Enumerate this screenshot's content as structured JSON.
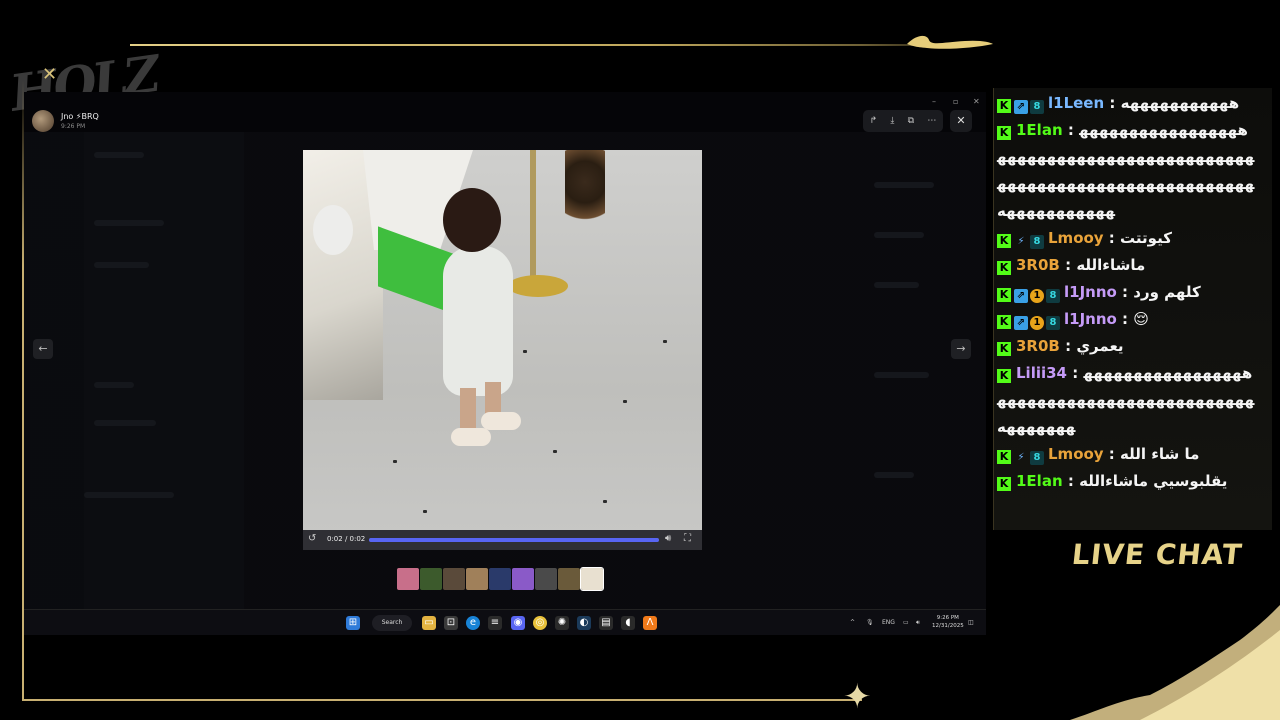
{
  "overlay": {
    "logo_text": "HOLZ",
    "live_chat_label": "LIVE CHAT",
    "accent": "#c8b072"
  },
  "viewer": {
    "user": "Jno ⚡BRQ",
    "time": "9:26 PM",
    "tools": [
      "share-icon",
      "download-icon",
      "open-external-icon",
      "more-icon"
    ],
    "close": "✕",
    "prev": "←",
    "next": "→",
    "video": {
      "time_display": "0:02 / 0:02",
      "progress": 1.0,
      "accent": "#5865f2"
    },
    "thumbnail_count": 9
  },
  "taskbar": {
    "search_label": "Search",
    "lang": "ENG",
    "clock_time": "9:26 PM",
    "clock_date": "12/31/2025"
  },
  "chat": {
    "messages": [
      {
        "badges": [
          "kick",
          "blue",
          "cyan"
        ],
        "user": "l1Leen",
        "color": "#79b8ff",
        "text": "هههههههههههه"
      },
      {
        "badges": [
          "kick"
        ],
        "user": "1Elan",
        "color": "#53fc18",
        "text": "ههههههههههههههههههههههههههههههههههههههههههههههههههههههههههههههههههههههههههههههههه"
      },
      {
        "badges": [
          "kick",
          "spark",
          "cyan"
        ],
        "user": "Lmooy",
        "color": "#e9a33a",
        "text": "كيوتتت"
      },
      {
        "badges": [
          "kick"
        ],
        "user": "3R0B",
        "color": "#e9a33a",
        "text": "ماشاءالله"
      },
      {
        "badges": [
          "kick",
          "blue",
          "gold",
          "cyan"
        ],
        "user": "l1Jnno",
        "color": "#c59bf7",
        "text": "كلهم ورد"
      },
      {
        "badges": [
          "kick",
          "blue",
          "gold",
          "cyan"
        ],
        "user": "l1Jnno",
        "color": "#c59bf7",
        "text": "😌"
      },
      {
        "badges": [
          "kick"
        ],
        "user": "3R0B",
        "color": "#e9a33a",
        "text": "يعمري"
      },
      {
        "badges": [
          "kick"
        ],
        "user": "Lilii34",
        "color": "#c59bf7",
        "text": "ههههههههههههههههههههههههههههههههههههههههههههههههههه"
      },
      {
        "badges": [
          "kick",
          "spark",
          "cyan"
        ],
        "user": "Lmooy",
        "color": "#e9a33a",
        "text": "ما شاء الله"
      },
      {
        "badges": [
          "kick"
        ],
        "user": "1Elan",
        "color": "#53fc18",
        "text": "يقلبوسيي ماشاءالله"
      }
    ]
  }
}
